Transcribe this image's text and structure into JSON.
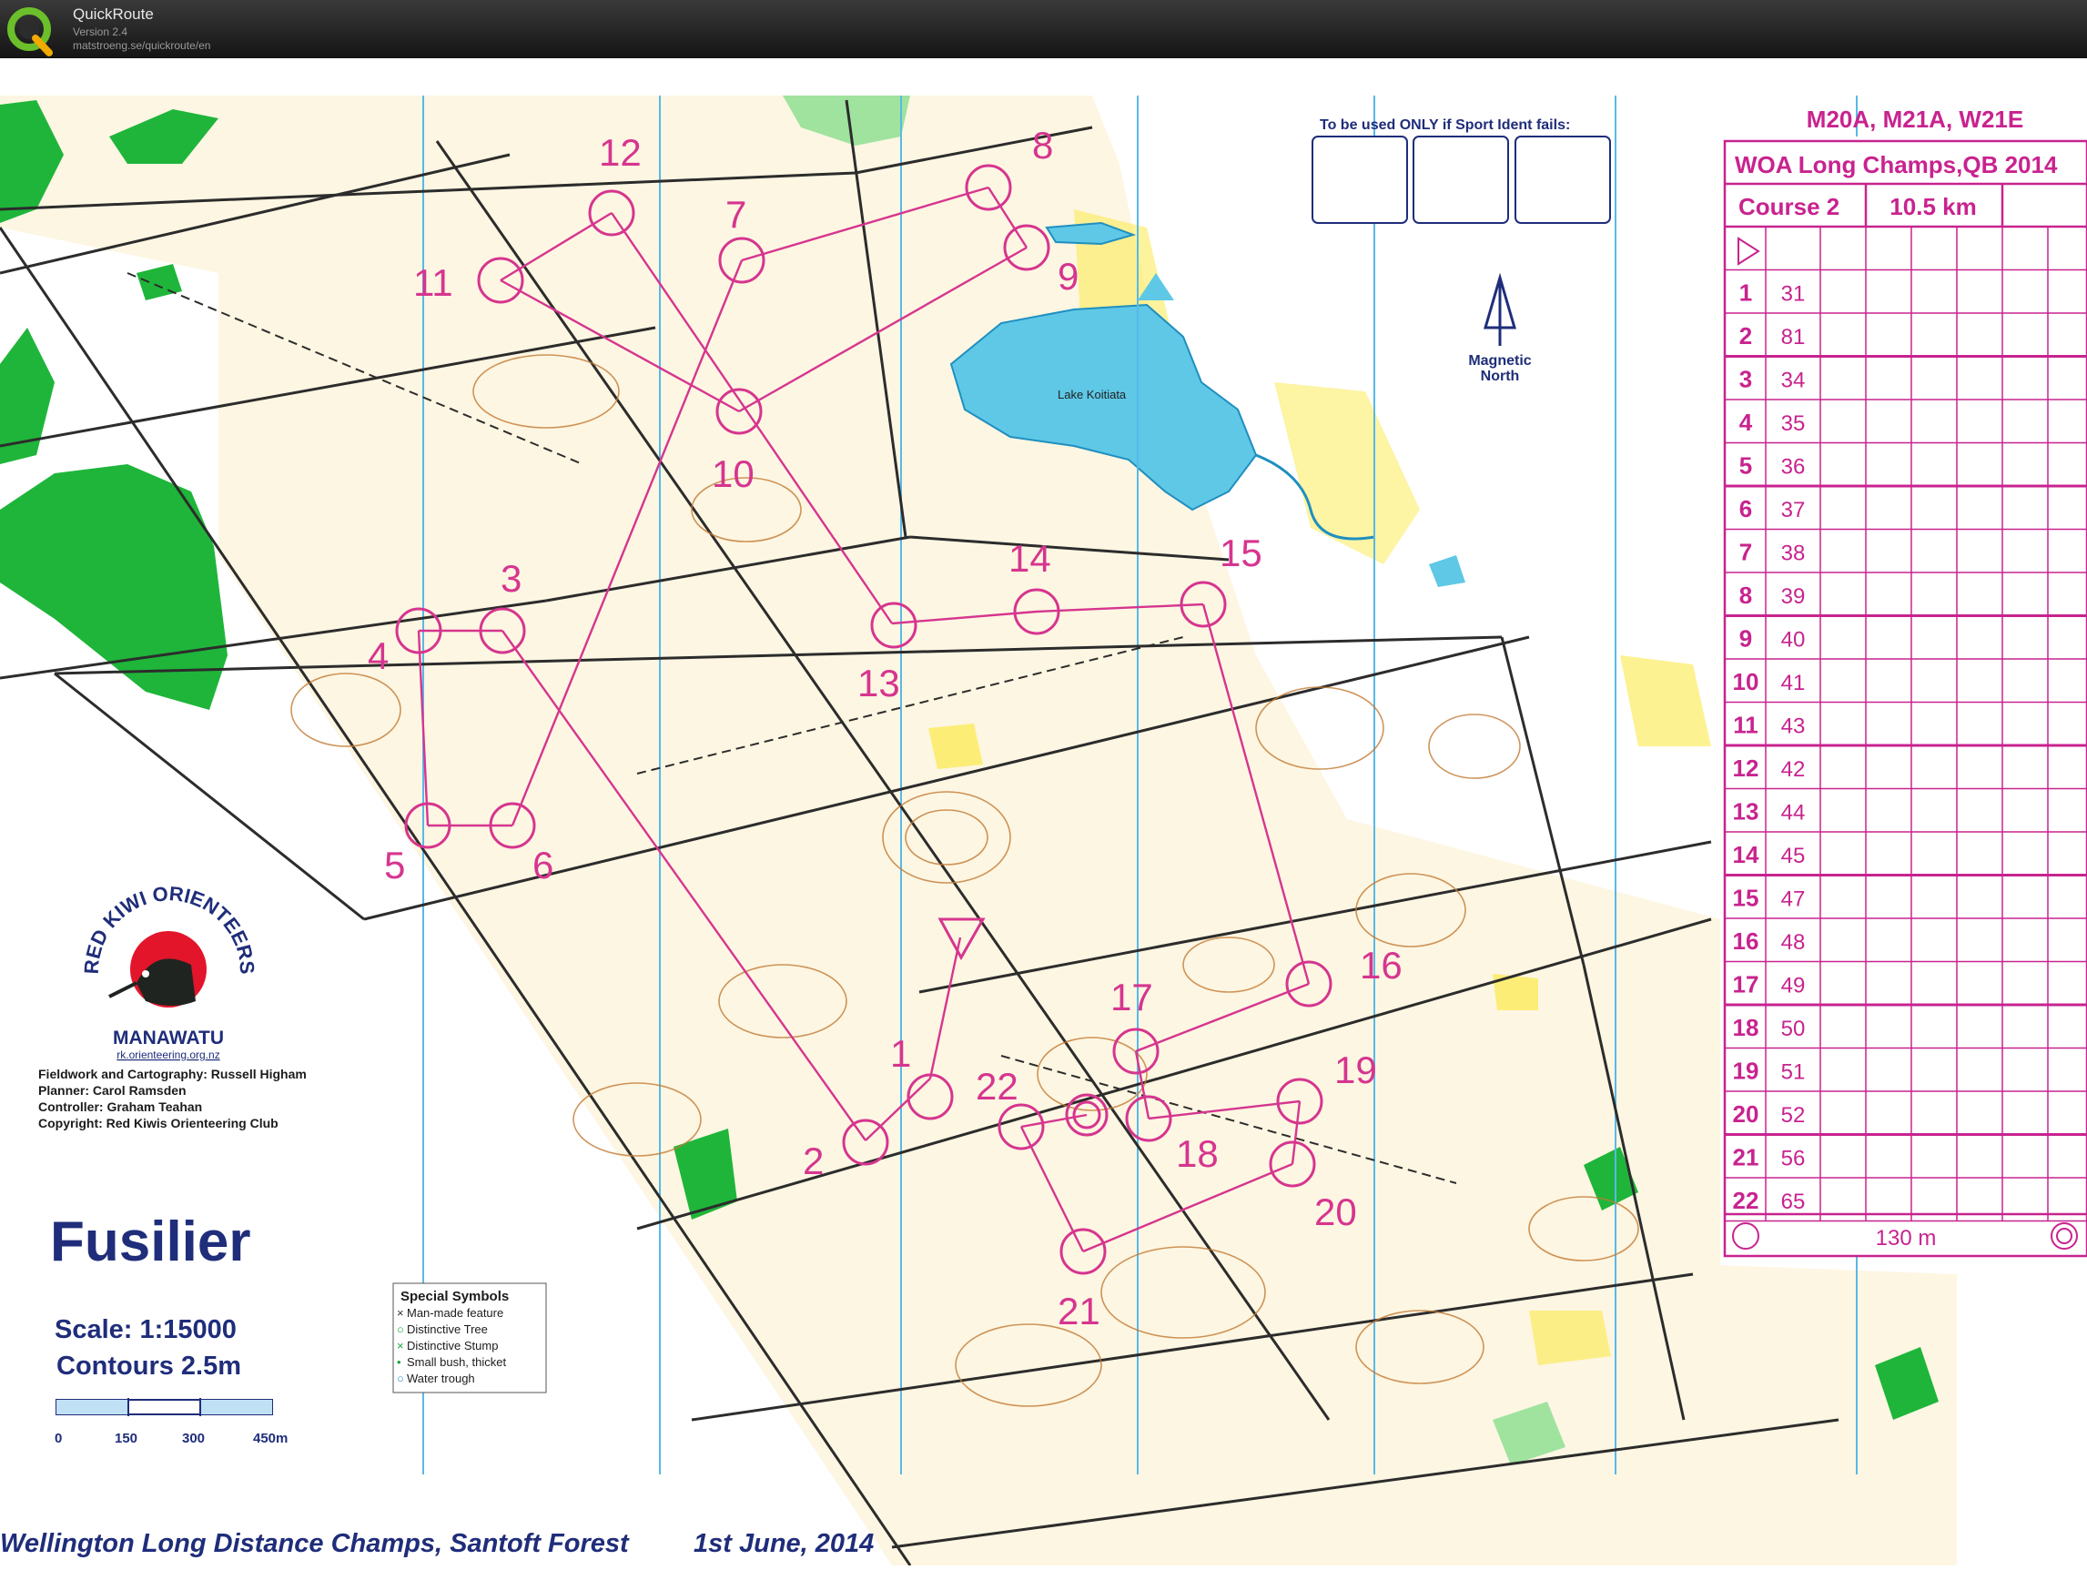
{
  "app": {
    "name": "QuickRoute",
    "version": "Version 2.4",
    "url": "matstroeng.se/quickroute/en"
  },
  "map": {
    "title": "Fusilier",
    "scale": "Scale: 1:15000",
    "contours": "Contours  2.5m",
    "scale_ticks": [
      "0",
      "150",
      "300",
      "450m"
    ],
    "footer_event": "Wellington Long Distance Champs, Santoft Forest",
    "footer_date": "1st June, 2014",
    "lake_name": "Lake Koitiata",
    "north_label_1": "Magnetic",
    "north_label_2": "North",
    "sport_ident_note": "To be used ONLY if Sport Ident fails:",
    "club": {
      "name": "RED KIWI ORIENTEERS",
      "region": "MANAWATU",
      "url": "rk.orienteering.org.nz"
    },
    "credits": [
      "Fieldwork and Cartography: Russell Higham",
      "Planner: Carol Ramsden",
      "Controller: Graham Teahan",
      "Copyright: Red Kiwis Orienteering Club"
    ],
    "special_symbols": {
      "title": "Special Symbols",
      "items": [
        {
          "symbol": "×",
          "label": "Man-made feature"
        },
        {
          "symbol": "○",
          "label": "Distinctive Tree"
        },
        {
          "symbol": "×",
          "label": "Distinctive Stump"
        },
        {
          "symbol": "•",
          "label": "Small bush, thicket"
        },
        {
          "symbol": "○",
          "label": "Water trough"
        }
      ]
    },
    "course": {
      "classes": "M20A, M21A, W21E",
      "event": "WOA Long Champs,QB 2014",
      "name": "Course 2",
      "length": "10.5 km",
      "finish_distance": "130 m",
      "controls": [
        {
          "n": "1",
          "code": "31"
        },
        {
          "n": "2",
          "code": "81"
        },
        {
          "n": "3",
          "code": "34"
        },
        {
          "n": "4",
          "code": "35"
        },
        {
          "n": "5",
          "code": "36"
        },
        {
          "n": "6",
          "code": "37"
        },
        {
          "n": "7",
          "code": "38"
        },
        {
          "n": "8",
          "code": "39"
        },
        {
          "n": "9",
          "code": "40"
        },
        {
          "n": "10",
          "code": "41"
        },
        {
          "n": "11",
          "code": "43"
        },
        {
          "n": "12",
          "code": "42"
        },
        {
          "n": "13",
          "code": "44"
        },
        {
          "n": "14",
          "code": "45"
        },
        {
          "n": "15",
          "code": "47"
        },
        {
          "n": "16",
          "code": "48"
        },
        {
          "n": "17",
          "code": "49"
        },
        {
          "n": "18",
          "code": "50"
        },
        {
          "n": "19",
          "code": "51"
        },
        {
          "n": "20",
          "code": "52"
        },
        {
          "n": "21",
          "code": "56"
        },
        {
          "n": "22",
          "code": "65"
        }
      ]
    }
  }
}
